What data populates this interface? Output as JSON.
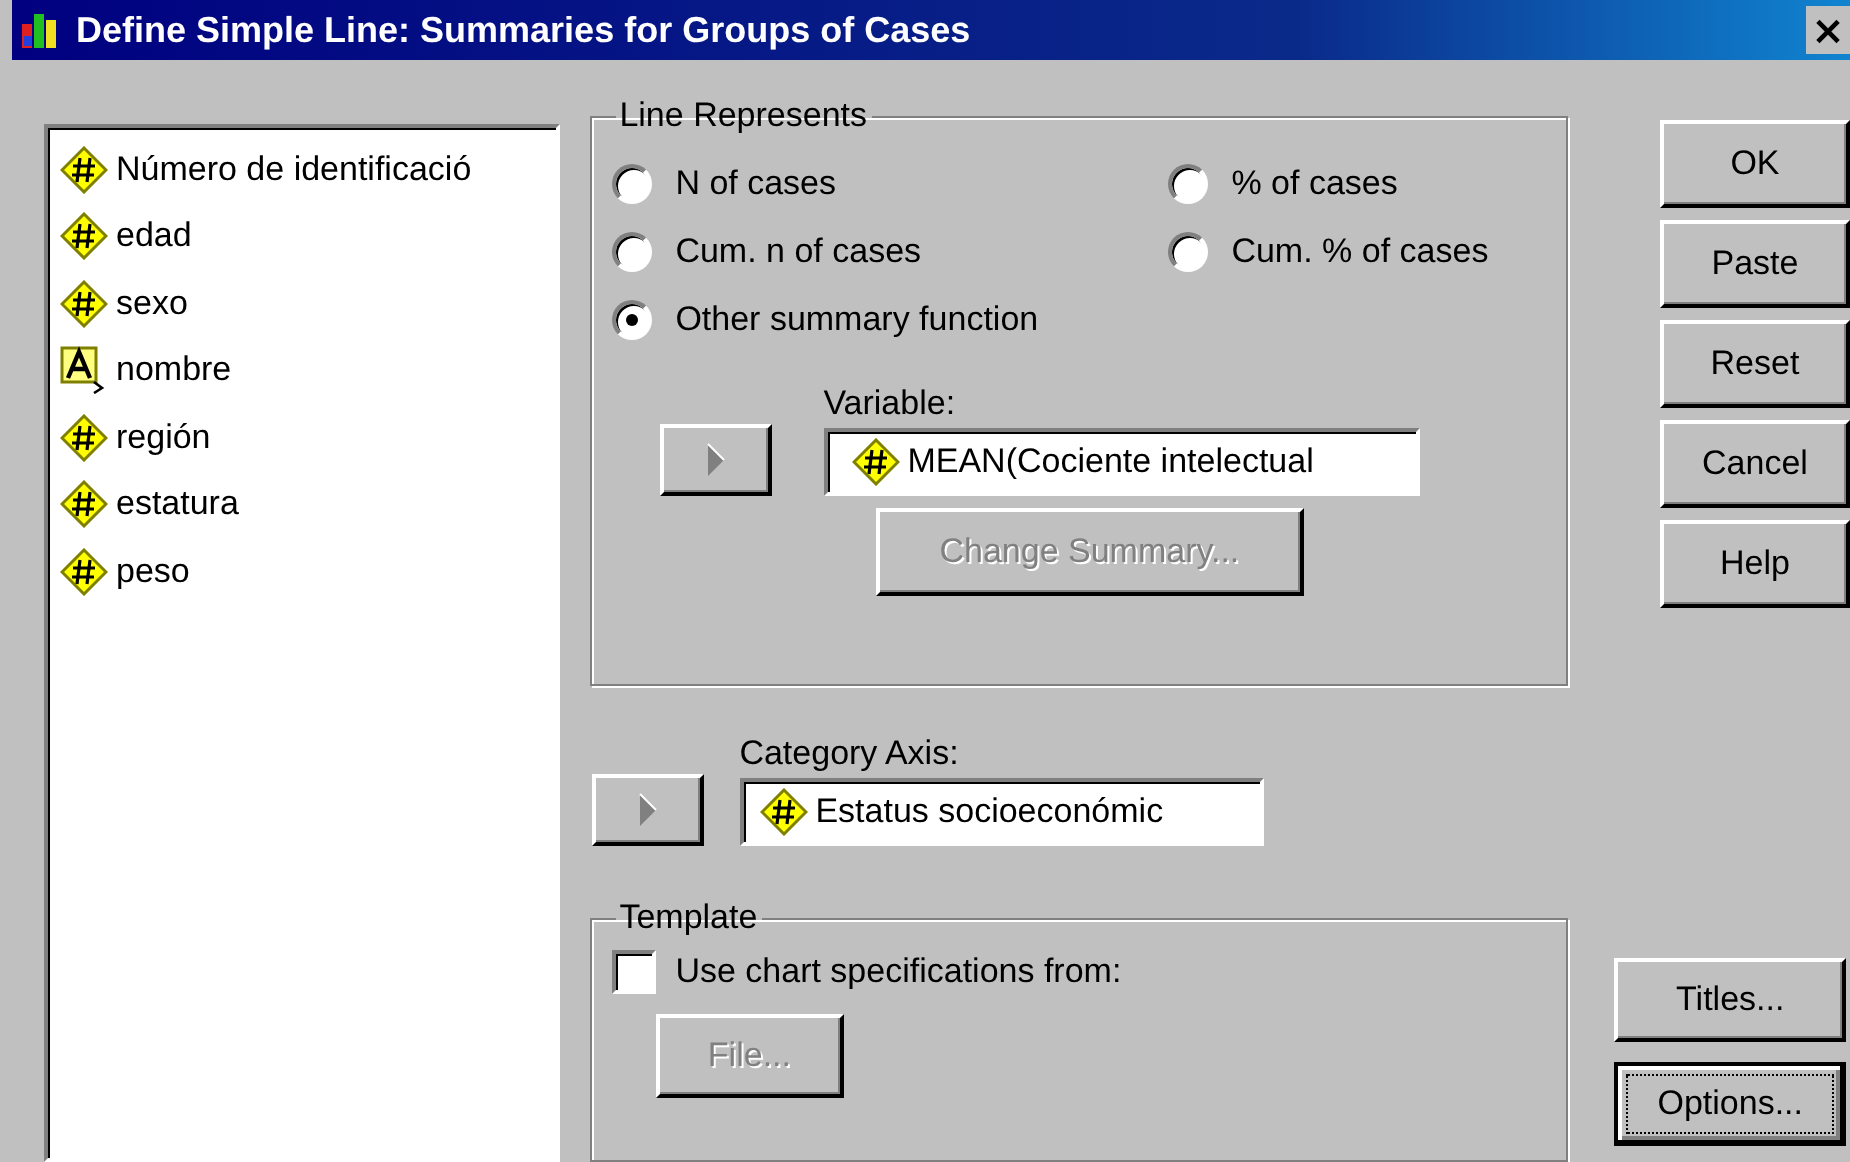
{
  "window": {
    "title": "Define Simple Line: Summaries for Groups of Cases",
    "close": "×"
  },
  "variables": [
    {
      "kind": "numeric",
      "name": "Número de identificació"
    },
    {
      "kind": "numeric",
      "name": "edad"
    },
    {
      "kind": "numeric",
      "name": "sexo"
    },
    {
      "kind": "string",
      "name": "nombre"
    },
    {
      "kind": "numeric",
      "name": "región"
    },
    {
      "kind": "numeric",
      "name": "estatura"
    },
    {
      "kind": "numeric",
      "name": "peso"
    }
  ],
  "line_represents": {
    "legend": "Line Represents",
    "options": [
      {
        "label": "N of cases",
        "selected": false
      },
      {
        "label": "% of cases",
        "selected": false
      },
      {
        "label": "Cum. n of cases",
        "selected": false
      },
      {
        "label": "Cum. % of cases",
        "selected": false
      },
      {
        "label": "Other summary function",
        "selected": true
      }
    ],
    "variable_label": "Variable:",
    "variable_value": {
      "kind": "numeric",
      "text": "MEAN(Cociente intelectual"
    },
    "change_summary": {
      "label": "Change Summary...",
      "disabled": true
    }
  },
  "category_axis": {
    "label": "Category Axis:",
    "value": {
      "kind": "numeric",
      "text": "Estatus socioeconómic"
    }
  },
  "template": {
    "legend": "Template",
    "use_spec": {
      "label": "Use chart specifications from:",
      "checked": false
    },
    "file": {
      "label": "File...",
      "disabled": true
    }
  },
  "buttons": [
    {
      "label": "OK",
      "focused": false
    },
    {
      "label": "Paste",
      "focused": false
    },
    {
      "label": "Reset",
      "focused": false
    },
    {
      "label": "Cancel",
      "focused": false
    },
    {
      "label": "Help",
      "focused": false
    }
  ],
  "side_buttons": [
    {
      "label": "Titles...",
      "focused": false
    },
    {
      "label": "Options...",
      "focused": true
    }
  ]
}
